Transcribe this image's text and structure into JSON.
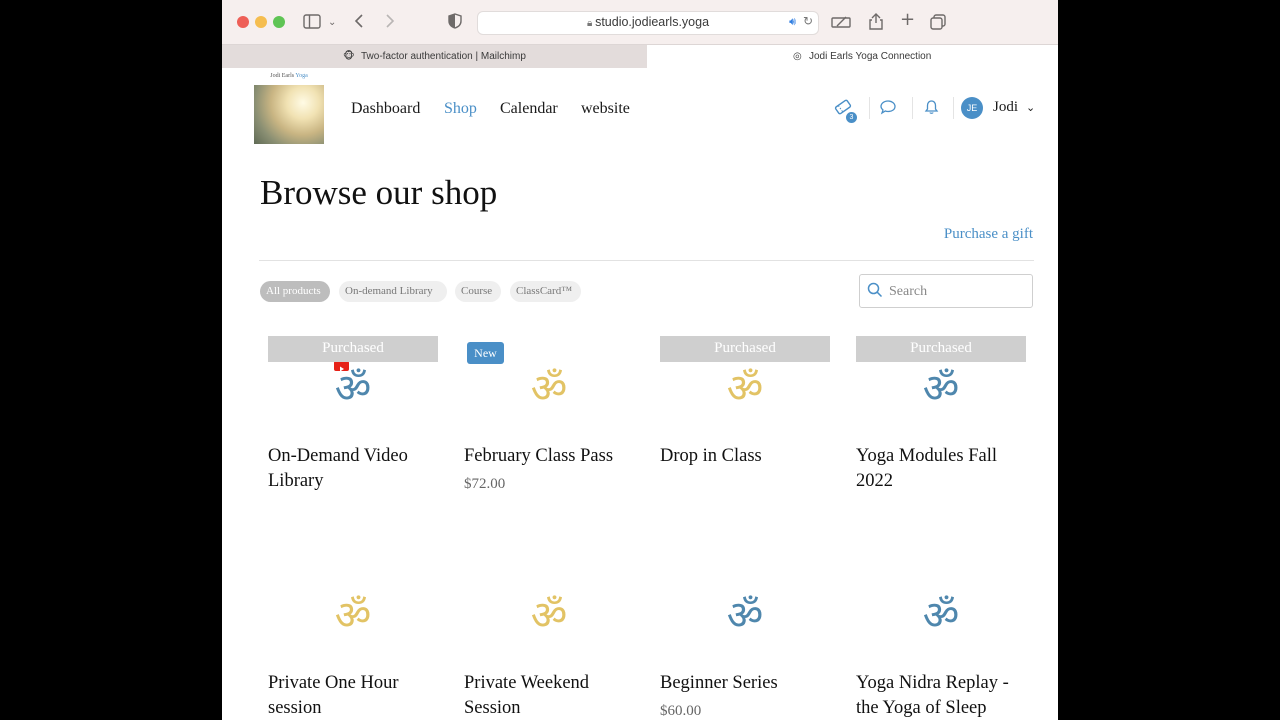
{
  "browser": {
    "url": "studio.jodiearls.yoga",
    "tabs": [
      {
        "label": "Two-factor authentication | Mailchimp",
        "active": false
      },
      {
        "label": "Jodi Earls Yoga Connection",
        "active": true
      }
    ]
  },
  "header": {
    "logo_text": "Jodi Earls Yoga",
    "nav": [
      "Dashboard",
      "Shop",
      "Calendar",
      "website"
    ],
    "active_nav": "Shop",
    "cart_count": "3",
    "avatar_initials": "JE",
    "user_name": "Jodi"
  },
  "page": {
    "title": "Browse our shop",
    "gift_link": "Purchase a gift",
    "filters": [
      "All products",
      "On-demand Library",
      "Course",
      "ClassCard™"
    ],
    "active_filter": "All products",
    "search_placeholder": "Search"
  },
  "products": [
    {
      "title": "On-Demand Video Library",
      "price": "",
      "banner": "Purchased",
      "om_color": "blue",
      "video_badge": true
    },
    {
      "title": "February Class Pass",
      "price": "$72.00",
      "tag": "New",
      "om_color": "gold"
    },
    {
      "title": "Drop in Class",
      "price": "",
      "banner": "Purchased",
      "om_color": "gold"
    },
    {
      "title": "Yoga Modules Fall 2022",
      "price": "",
      "banner": "Purchased",
      "om_color": "blue"
    },
    {
      "title": "Private One Hour session",
      "price": "",
      "om_color": "gold"
    },
    {
      "title": "Private Weekend Session",
      "price": "",
      "om_color": "gold"
    },
    {
      "title": "Beginner Series",
      "price": "$60.00",
      "om_color": "blue"
    },
    {
      "title": "Yoga Nidra Replay - the Yoga of Sleep",
      "price": "",
      "om_color": "blue"
    }
  ],
  "colors": {
    "accent": "#4a8fc7",
    "om_gold": "#e2c365",
    "om_blue": "#4f87ad",
    "om_dark": "#1f2a55",
    "banner_gray": "#cfcfcf"
  }
}
